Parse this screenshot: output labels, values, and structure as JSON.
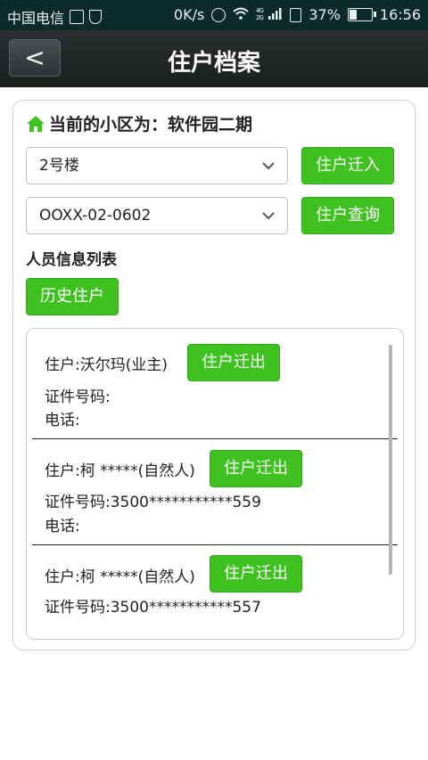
{
  "status_bar": {
    "carrier": "中国电信",
    "speed": "0K/s",
    "network": "4G 2G",
    "battery": "37%",
    "battery_level": 0.37,
    "time": "16:56"
  },
  "header": {
    "back_label": "<",
    "title": "住户档案"
  },
  "community": {
    "label": "当前的小区为：软件园二期",
    "icon": "house-icon",
    "icon_color": "#3fc21f"
  },
  "building_select": {
    "value": "2号楼"
  },
  "room_select": {
    "value": "OOXX-02-0602"
  },
  "buttons": {
    "move_in": "住户迁入",
    "query": "住户查询",
    "history": "历史住户",
    "move_out": "住户迁出"
  },
  "list_heading": "人员信息列表",
  "residents": [
    {
      "name": "住户:沃尔玛(业主)",
      "id": "证件号码:",
      "phone": "电话:"
    },
    {
      "name": "住户:柯 *****(自然人)",
      "id": "证件号码:3500***********559",
      "phone": "电话:"
    },
    {
      "name": "住户:柯 *****(自然人)",
      "id": "证件号码:3500***********557"
    }
  ],
  "colors": {
    "accent": "#3fc21f",
    "header_bg": "#1f2324",
    "status_bg": "#0d2a2a"
  }
}
